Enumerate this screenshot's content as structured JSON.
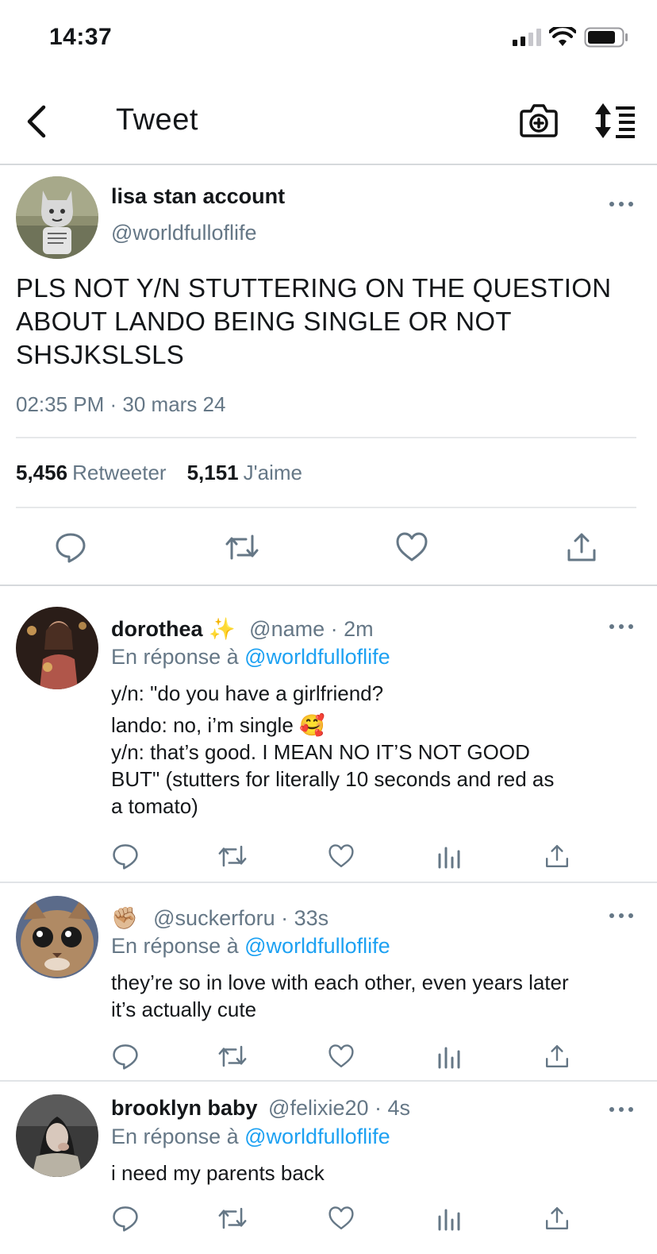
{
  "status_bar": {
    "time": "14:37"
  },
  "nav": {
    "title": "Tweet"
  },
  "main_tweet": {
    "display_name": "lisa stan account",
    "handle": "@worldfulloflife",
    "text_lines": [
      "PLS NOT Y/N STUTTERING ON THE QUESTION",
      "ABOUT LANDO BEING SINGLE OR NOT",
      "SHSJKSLSLS"
    ],
    "timestamp": "02:35 PM · 30 mars 24",
    "retweets_count": "5,456",
    "retweets_label": "Retweeter",
    "likes_count": "5,151",
    "likes_label": "J'aime"
  },
  "replies": [
    {
      "display_name": "dorothea",
      "name_emoji": "✨",
      "handle_time": "@name · 2m",
      "reply_prefix": "En réponse à",
      "reply_to": "@worldfulloflife",
      "lines": [
        "y/n: \"do you have a girlfriend?",
        "lando: no, i’m single 🥰",
        "y/n: that’s good. I MEAN NO IT’S NOT GOOD",
        "BUT\" (stutters for literally 10 seconds and red as",
        "a tomato)"
      ]
    },
    {
      "display_name": "",
      "name_emoji": "✊🏼",
      "handle_time": "@suckerforu · 33s",
      "reply_prefix": "En réponse à",
      "reply_to": "@worldfulloflife",
      "lines": [
        "they’re so in love with each other, even years later",
        "it’s actually cute"
      ]
    },
    {
      "display_name": "brooklyn baby",
      "name_emoji": "",
      "handle_time": "@felixie20 · 4s",
      "reply_prefix": "En réponse à",
      "reply_to": "@worldfulloflife",
      "lines": [
        "i need my parents back"
      ]
    }
  ],
  "colors": {
    "link": "#1da1f2",
    "secondary_text": "#657786",
    "icon": "#657786"
  }
}
